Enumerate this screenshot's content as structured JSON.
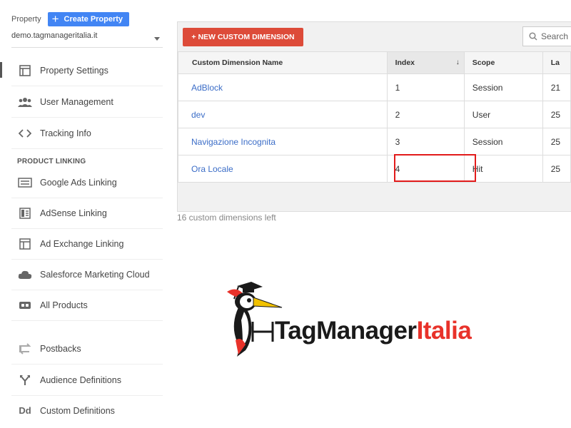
{
  "sidebar": {
    "property_label": "Property",
    "create_button": "Create Property",
    "account_value": "demo.tagmanageritalia.it",
    "items": [
      {
        "label": "Property Settings",
        "icon": "property-settings-icon"
      },
      {
        "label": "User Management",
        "icon": "users-icon"
      },
      {
        "label": "Tracking Info",
        "icon": "code-icon"
      }
    ],
    "section_label": "PRODUCT LINKING",
    "linking_items": [
      {
        "label": "Google Ads Linking",
        "icon": "google-ads-icon"
      },
      {
        "label": "AdSense Linking",
        "icon": "adsense-icon"
      },
      {
        "label": "Ad Exchange Linking",
        "icon": "ad-exchange-icon"
      },
      {
        "label": "Salesforce Marketing Cloud",
        "icon": "cloud-icon"
      },
      {
        "label": "All Products",
        "icon": "link-icon"
      }
    ],
    "other_items": [
      {
        "label": "Postbacks",
        "icon": "postbacks-icon"
      },
      {
        "label": "Audience Definitions",
        "icon": "audience-icon"
      },
      {
        "label": "Custom Definitions",
        "icon": "dd-icon"
      }
    ]
  },
  "main": {
    "new_button": "+ NEW CUSTOM DIMENSION",
    "search_placeholder": "Search",
    "columns": [
      "Custom Dimension Name",
      "Index",
      "Scope",
      "La"
    ],
    "rows": [
      {
        "name": "AdBlock",
        "index": "1",
        "scope": "Session",
        "last": "21"
      },
      {
        "name": "dev",
        "index": "2",
        "scope": "User",
        "last": "25"
      },
      {
        "name": "Navigazione Incognita",
        "index": "3",
        "scope": "Session",
        "last": "25"
      },
      {
        "name": "Ora Locale",
        "index": "4",
        "scope": "Hit",
        "last": "25"
      }
    ],
    "footer": "16 custom dimensions left"
  },
  "logo": {
    "word1": "TagManager",
    "word2": "Italia",
    "colors": {
      "dark": "#1a1a1a",
      "red": "#e8322a",
      "beak": "#f2c200"
    }
  },
  "colors": {
    "primary": "#4285f4",
    "danger": "#dd4b39",
    "link": "#3b6dc7",
    "highlight": "#e21b1b"
  }
}
